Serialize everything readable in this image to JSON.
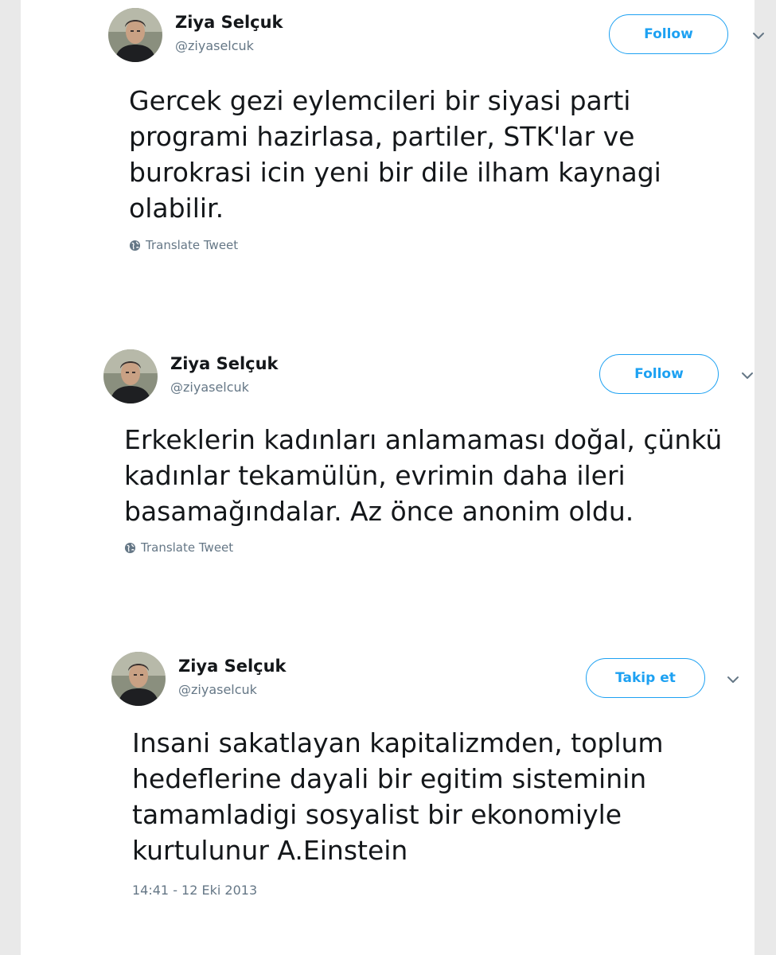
{
  "tweets": [
    {
      "author_name": "Ziya Selçuk",
      "author_handle": "@ziyaselcuk",
      "follow_label": "Follow",
      "text_lines": [
        "Gercek gezi eylemcileri bir siyasi parti",
        "programi hazirlasa, partiler, STK'lar ve",
        "burokrasi icin yeni bir dile ilham kaynagi",
        "olabilir."
      ],
      "translate_label": "Translate Tweet"
    },
    {
      "author_name": "Ziya Selçuk",
      "author_handle": "@ziyaselcuk",
      "follow_label": "Follow",
      "text_lines": [
        "Erkeklerin kadınları anlamaması doğal, çünkü",
        "kadınlar tekamülün, evrimin daha ileri",
        "basamağındalar. Az önce anonim oldu."
      ],
      "translate_label": "Translate Tweet"
    },
    {
      "author_name": "Ziya Selçuk",
      "author_handle": "@ziyaselcuk",
      "follow_label": "Takip et",
      "text_lines": [
        "Insani sakatlayan  kapitalizmden, toplum",
        "hedeflerine dayali bir egitim sisteminin",
        "tamamladigi sosyalist bir ekonomiyle",
        "kurtulunur A.Einstein"
      ],
      "timestamp": "14:41 - 12 Eki 2013"
    }
  ],
  "colors": {
    "accent": "#1da1f2",
    "text": "#14171a",
    "muted": "#657786"
  },
  "icons": {
    "avatar": "profile-photo",
    "menu": "chevron-down-icon",
    "translate": "globe-icon"
  }
}
